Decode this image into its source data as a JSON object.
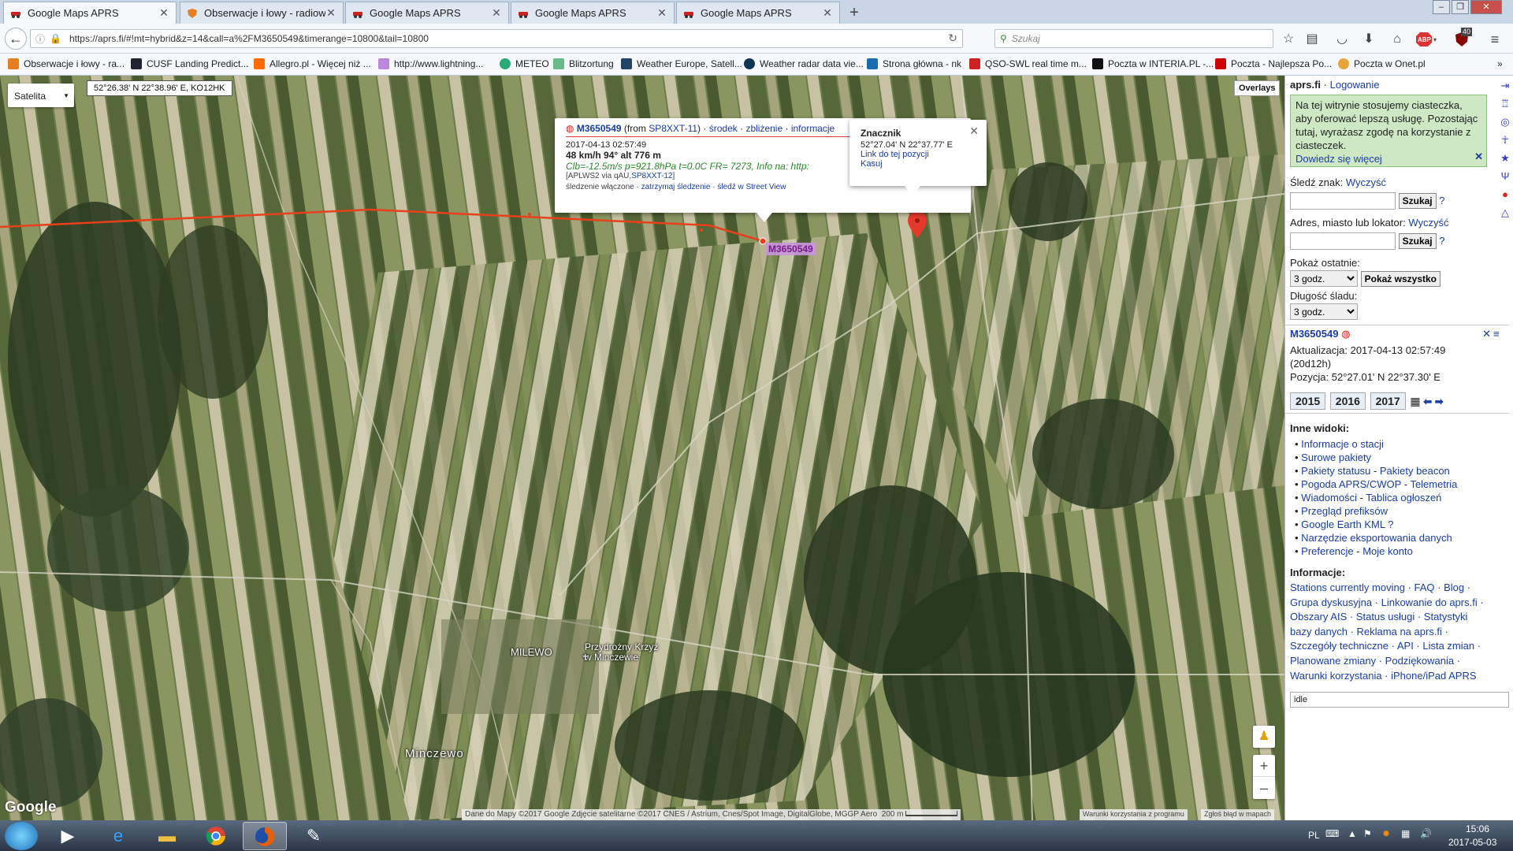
{
  "browser": {
    "tabs": [
      {
        "title": "Google Maps APRS",
        "active": true,
        "color": "#c22"
      },
      {
        "title": "Obserwacje i łowy - radiowe",
        "active": false,
        "color": "#e67e22"
      },
      {
        "title": "Google Maps APRS",
        "active": false,
        "color": "#c22"
      },
      {
        "title": "Google Maps APRS",
        "active": false,
        "color": "#c22"
      },
      {
        "title": "Google Maps APRS",
        "active": false,
        "color": "#c22"
      }
    ],
    "url": "https://aprs.fi/#!mt=hybrid&z=14&call=a%2FM3650549&timerange=10800&tail=10800",
    "search_placeholder": "Szukaj",
    "bookmarks": [
      {
        "label": "Obserwacje i łowy - ra...",
        "color": "#e67e22"
      },
      {
        "label": "CUSF Landing Predict...",
        "color": "#223"
      },
      {
        "label": "Allegro.pl - Więcej niż ...",
        "color": "#ff6a00"
      },
      {
        "label": "http://www.lightning...",
        "color": "#b8d"
      },
      {
        "label": "METEO",
        "color": "#2aa876"
      },
      {
        "label": "Blitzortung",
        "color": "#6b8"
      },
      {
        "label": "Weather Europe, Satell...",
        "color": "#246"
      },
      {
        "label": "Weather radar data vie...",
        "color": "#135"
      },
      {
        "label": "Strona główna - nk",
        "color": "#1a6bb0"
      },
      {
        "label": "QSO-SWL real time m...",
        "color": "#c22"
      },
      {
        "label": "Poczta w INTERIA.PL -...",
        "color": "#111"
      },
      {
        "label": "Poczta - Najlepsza Po...",
        "color": "#c00"
      },
      {
        "label": "Poczta w Onet.pl",
        "color": "#e9a53a"
      }
    ],
    "badge_count": "40"
  },
  "map": {
    "type_selector": "Satelita",
    "cursor_coords": "52°26.38' N 22°38.96' E, KO12HK",
    "overlays_label": "Overlays",
    "station_label": "M3650549",
    "place_milewo": "MILEWO",
    "place_minczewo": "Minczewo",
    "place_cross": "Przydrożny Krzyż\nw Minczewie",
    "google_logo": "Google",
    "attribution": "Dane do Mapy ©2017 Google Zdjęcie satelitarne ©2017 CNES / Astrium, Cnes/Spot Image, DigitalGlobe, MGGP Aero",
    "scale": "200 m",
    "terms": "Warunki korzystania z programu",
    "report": "Zgłoś błąd w mapach",
    "popup": {
      "callsign": "M3650549",
      "from_text": "(from",
      "from_call": "SP8XXT-11",
      "from_close": ")",
      "link_center": "środek",
      "link_zoom": "zbliżenie",
      "link_info": "informacje",
      "sep": "·",
      "time": "2017-04-13 02:57:49",
      "speed": "48 km/h 94° alt 776 m",
      "comment": "Clb=-12.5m/s p=921.8hPa t=0.0C FR= 7273, Info na: http:",
      "path_prefix": "[APLWS2 via qAU,",
      "path_call": "SP8XXT-12",
      "path_suffix": "]",
      "tracking_on": "śledzenie włączone",
      "tracking_stop": "zatrzymaj śledzenie",
      "street_view": "śledź w Street View"
    },
    "marker_popup": {
      "title": "Znacznik",
      "coords": "52°27.04' N 22°37.77' E",
      "link": "Link do tej pozycji",
      "delete": "Kasuj"
    }
  },
  "sidebar": {
    "site": "aprs.fi",
    "dot": "·",
    "login": "Logowanie",
    "cookie_text": "Na tej witrynie stosujemy ciasteczka, aby oferować lepszą usługę. Pozostając tutaj, wyrażasz zgodę na korzystanie z ciasteczek.",
    "cookie_link": "Dowiedz się więcej",
    "track_label": "Śledź znak:",
    "clear": "Wyczyść",
    "search_btn": "Szukaj",
    "help": "?",
    "address_label": "Adres, miasto lub lokator:",
    "show_last_label": "Pokaż ostatnie:",
    "show_last_value": "3 godz.",
    "show_all_btn": "Pokaż wszystko",
    "trail_label": "Długość śladu:",
    "trail_value": "3 godz.",
    "station": {
      "callsign": "M3650549",
      "updated": "Aktualizacja: 2017-04-13 02:57:49",
      "age": "(20d12h)",
      "position": "Pozycja: 52°27.01' N 22°37.30' E"
    },
    "years": [
      "2015",
      "2016",
      "2017"
    ],
    "other_views_title": "Inne widoki:",
    "other_views": [
      {
        "a": "Informacje o stacji",
        "b": ""
      },
      {
        "a": "Surowe pakiety",
        "b": ""
      },
      {
        "a": "Pakiety statusu",
        "b": "Pakiety beacon"
      },
      {
        "a": "Pogoda APRS/CWOP",
        "b": "Telemetria"
      },
      {
        "a": "Wiadomości",
        "b": "Tablica ogłoszeń"
      },
      {
        "a": "Przegląd prefiksów",
        "b": ""
      },
      {
        "a": "Google Earth KML",
        "b": "?"
      },
      {
        "a": "Narzędzie eksportowania danych",
        "b": ""
      },
      {
        "a": "Preferencje",
        "b": "Moje konto"
      }
    ],
    "info_title": "Informacje:",
    "info_lines": [
      "Stations currently moving · FAQ · Blog ·",
      "Grupa dyskusyjna · Linkowanie do aprs.fi ·",
      "Obszary AIS · Status usługi · Statystyki",
      "bazy danych · Reklama na aprs.fi ·",
      "Szczegóły techniczne · API · Lista zmian ·",
      "Planowane zmiany · Podziękowania ·",
      "Warunki korzystania · iPhone/iPad APRS"
    ],
    "status_input": "idle"
  },
  "taskbar": {
    "lang": "PL",
    "time": "15:06",
    "date": "2017-05-03"
  },
  "colors": {
    "link": "#1a3ea8",
    "track": "#e8401a",
    "cookie_bg": "#cfe8c4"
  }
}
